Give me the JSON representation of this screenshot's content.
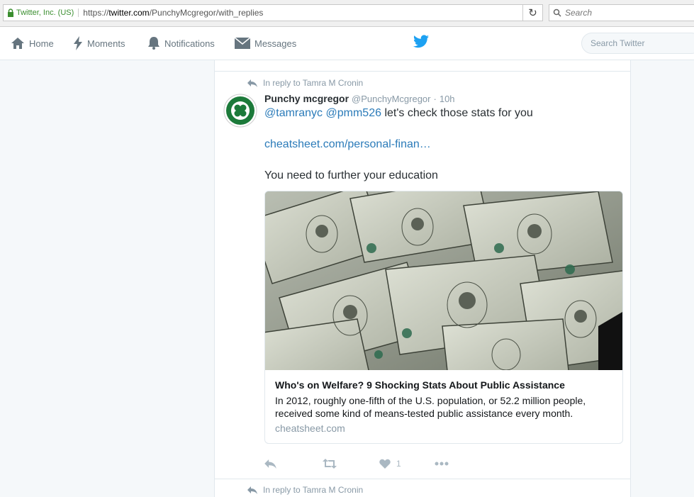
{
  "browser": {
    "identity": "Twitter, Inc. (US)",
    "url_prefix": "https://",
    "url_domain": "twitter.com",
    "url_path": "/PunchyMcgregor/with_replies",
    "search_placeholder": "Search"
  },
  "nav": {
    "home": "Home",
    "moments": "Moments",
    "notifications": "Notifications",
    "messages": "Messages",
    "search_placeholder": "Search Twitter"
  },
  "tweet": {
    "reply_context": "In reply to Tamra M Cronin",
    "fullname": "Punchy mcgregor",
    "handle": "@PunchyMcgregor",
    "separator": "·",
    "time": "10h",
    "mention1": "@tamranyc",
    "mention2": "@pmm526",
    "text1": " let's check those stats for you",
    "link": "cheatsheet.com/personal-finan…",
    "text2": "You need to further your education",
    "card": {
      "title": "Who's on Welfare? 9 Shocking Stats About Public Assistance",
      "description": "In 2012, roughly one-fifth of the U.S. population, or 52.2 million people, received some kind of means-tested public assistance every month.",
      "domain": "cheatsheet.com"
    },
    "actions": {
      "like_count": "1"
    }
  },
  "next_tweet": {
    "reply_context": "In reply to Tamra M Cronin"
  }
}
